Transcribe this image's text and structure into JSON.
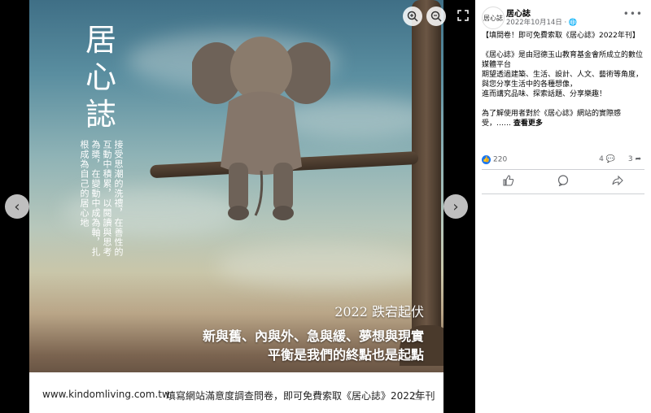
{
  "viewer": {
    "image": {
      "title_chars": [
        "居",
        "心",
        "誌"
      ],
      "tagline": "接受思潮的洗禮，在善性的互動中積累，以閱讀與思考為槳，在變動中成為軸，扎根成為自己的居心地",
      "slogan_year": "2022 跌宕起伏",
      "slogan_line1": "新與舊、內與外、急與緩、夢想與現實",
      "slogan_line2": "平衡是我們的終點也是起點",
      "bottom_url": "www.kindomliving.com.tw",
      "bottom_text": "填寫網站滿意度調查問卷，即可免費索取《居心誌》2022年刊"
    },
    "controls": {
      "prev_icon": "chevron-left-icon",
      "next_icon": "chevron-right-icon",
      "zoom_in_icon": "zoom-in-icon",
      "zoom_out_icon": "zoom-out-icon",
      "expand_icon": "expand-icon"
    }
  },
  "post": {
    "avatar_text": "居心誌",
    "page_name": "居心誌",
    "date": "2022年10月14日 · ",
    "privacy_icon": "globe-icon",
    "paragraph1": "【填問卷！即可免費索取《居心誌》2022年刊】",
    "paragraph2_lines": [
      "《居心誌》是由冠德玉山教育基金會所成立的數位媒體平台",
      "期望透過建築、生活、設計、人文、藝術等角度，",
      "與您分享生活中的各種想像，",
      "進而講究品味、探索話題、分享樂趣！"
    ],
    "paragraph3": "為了解使用者對於《居心誌》網站的實際感受，……",
    "see_more": "查看更多",
    "reactions_count": "220",
    "comments_count": "4",
    "shares_count": "3"
  },
  "colors": {
    "facebook_blue": "#1877f2",
    "secondary_text": "#65676b"
  }
}
